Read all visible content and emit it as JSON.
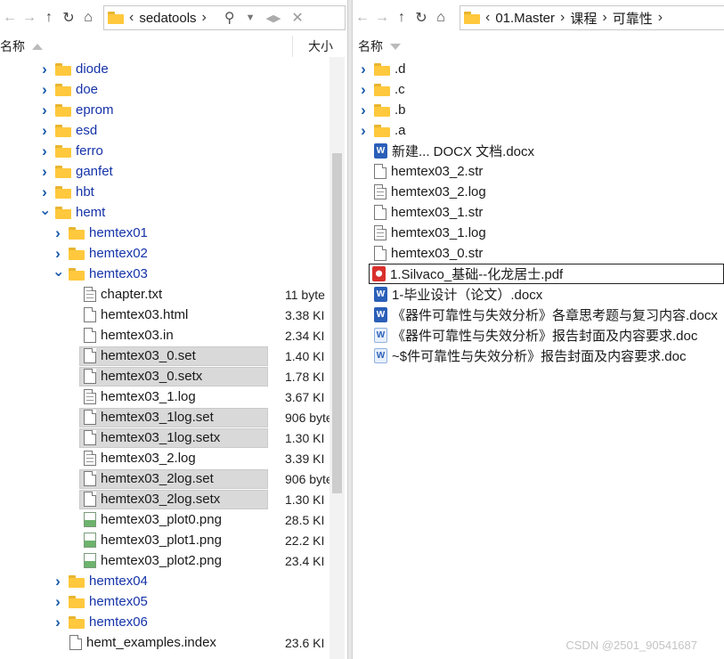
{
  "left": {
    "address": {
      "folder": "sedatools"
    },
    "columns": {
      "name": "名称",
      "size": "大小"
    },
    "rows": [
      {
        "type": "folder",
        "depth": 1,
        "expanded": false,
        "name": "diode"
      },
      {
        "type": "folder",
        "depth": 1,
        "expanded": false,
        "name": "doe"
      },
      {
        "type": "folder",
        "depth": 1,
        "expanded": false,
        "name": "eprom"
      },
      {
        "type": "folder",
        "depth": 1,
        "expanded": false,
        "name": "esd"
      },
      {
        "type": "folder",
        "depth": 1,
        "expanded": false,
        "name": "ferro"
      },
      {
        "type": "folder",
        "depth": 1,
        "expanded": false,
        "name": "ganfet"
      },
      {
        "type": "folder",
        "depth": 1,
        "expanded": false,
        "name": "hbt"
      },
      {
        "type": "folder",
        "depth": 1,
        "expanded": true,
        "name": "hemt"
      },
      {
        "type": "folder",
        "depth": 2,
        "expanded": false,
        "name": "hemtex01"
      },
      {
        "type": "folder",
        "depth": 2,
        "expanded": false,
        "name": "hemtex02"
      },
      {
        "type": "folder",
        "depth": 2,
        "expanded": true,
        "name": "hemtex03"
      },
      {
        "type": "txt",
        "depth": 3,
        "name": "chapter.txt",
        "size": "11 byte"
      },
      {
        "type": "file",
        "depth": 3,
        "name": "hemtex03.html",
        "size": "3.38 KI"
      },
      {
        "type": "file",
        "depth": 3,
        "name": "hemtex03.in",
        "size": "2.34 KI"
      },
      {
        "type": "file",
        "depth": 3,
        "name": "hemtex03_0.set",
        "size": "1.40 KI",
        "selected": true
      },
      {
        "type": "file",
        "depth": 3,
        "name": "hemtex03_0.setx",
        "size": "1.78 KI",
        "selected": true
      },
      {
        "type": "txt",
        "depth": 3,
        "name": "hemtex03_1.log",
        "size": "3.67 KI"
      },
      {
        "type": "file",
        "depth": 3,
        "name": "hemtex03_1log.set",
        "size": "906 byte",
        "selected": true
      },
      {
        "type": "file",
        "depth": 3,
        "name": "hemtex03_1log.setx",
        "size": "1.30 KI",
        "selected": true
      },
      {
        "type": "txt",
        "depth": 3,
        "name": "hemtex03_2.log",
        "size": "3.39 KI"
      },
      {
        "type": "file",
        "depth": 3,
        "name": "hemtex03_2log.set",
        "size": "906 byte",
        "selected": true
      },
      {
        "type": "file",
        "depth": 3,
        "name": "hemtex03_2log.setx",
        "size": "1.30 KI",
        "selected": true
      },
      {
        "type": "png",
        "depth": 3,
        "name": "hemtex03_plot0.png",
        "size": "28.5 KI"
      },
      {
        "type": "png",
        "depth": 3,
        "name": "hemtex03_plot1.png",
        "size": "22.2 KI"
      },
      {
        "type": "png",
        "depth": 3,
        "name": "hemtex03_plot2.png",
        "size": "23.4 KI"
      },
      {
        "type": "folder",
        "depth": 2,
        "expanded": false,
        "name": "hemtex04"
      },
      {
        "type": "folder",
        "depth": 2,
        "expanded": false,
        "name": "hemtex05"
      },
      {
        "type": "folder",
        "depth": 2,
        "expanded": false,
        "name": "hemtex06"
      },
      {
        "type": "file",
        "depth": 2,
        "name": "hemt_examples.index",
        "size": "23.6 KI"
      }
    ]
  },
  "right": {
    "address": {
      "crumbs": [
        "01.Master",
        "课程",
        "可靠性"
      ]
    },
    "columns": {
      "name": "名称"
    },
    "rows": [
      {
        "type": "folder",
        "expanded": false,
        "name": ".d"
      },
      {
        "type": "folder",
        "expanded": false,
        "name": ".c"
      },
      {
        "type": "folder",
        "expanded": false,
        "name": ".b"
      },
      {
        "type": "folder",
        "expanded": false,
        "name": ".a"
      },
      {
        "type": "word",
        "name": "新建... DOCX 文档.docx"
      },
      {
        "type": "file",
        "name": "hemtex03_2.str"
      },
      {
        "type": "txt",
        "name": "hemtex03_2.log"
      },
      {
        "type": "file",
        "name": "hemtex03_1.str"
      },
      {
        "type": "txt",
        "name": "hemtex03_1.log"
      },
      {
        "type": "file",
        "name": "hemtex03_0.str"
      },
      {
        "type": "pdf",
        "name": "1.Silvaco_基础--化龙居士.pdf",
        "focused": true
      },
      {
        "type": "word",
        "name": "1-毕业设计（论文）.docx"
      },
      {
        "type": "word",
        "name": "《器件可靠性与失效分析》各章思考题与复习内容.docx"
      },
      {
        "type": "word-light",
        "name": "《器件可靠性与失效分析》报告封面及内容要求.doc"
      },
      {
        "type": "word-light",
        "name": "~$件可靠性与失效分析》报告封面及内容要求.doc"
      }
    ]
  },
  "watermark": "CSDN @2501_90541687"
}
